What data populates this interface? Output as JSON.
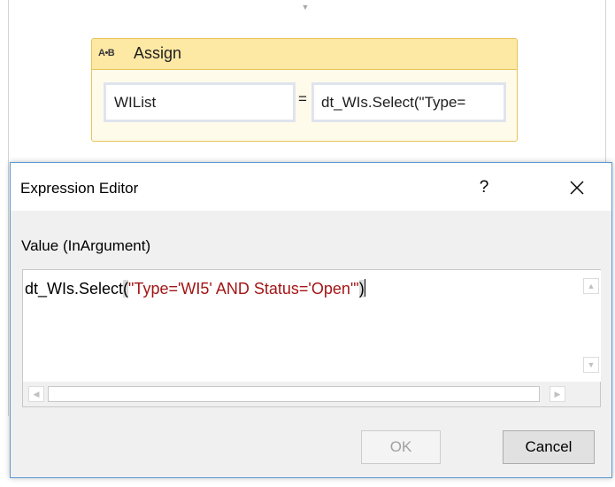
{
  "designer": {
    "connector_icon": "chevron-down-icon"
  },
  "assign": {
    "icon_text": "A•B",
    "title": "Assign",
    "to_value": "WIList",
    "equals": "=",
    "value_text": "dt_WIs.Select(\"Type="
  },
  "dialog": {
    "title": "Expression Editor",
    "help_label": "?",
    "close_icon": "close-icon",
    "value_label": "Value (InArgument)",
    "expression": {
      "prefix": "dt_WIs.Select",
      "open_paren": "(",
      "string_literal": "\"Type='WI5' AND Status='Open'\"",
      "close_paren": ")"
    },
    "ok_label": "OK",
    "cancel_label": "Cancel",
    "colors": {
      "border_accent": "#5b9bd5",
      "string_color": "#a31515",
      "assign_header": "#fde8a4"
    }
  }
}
